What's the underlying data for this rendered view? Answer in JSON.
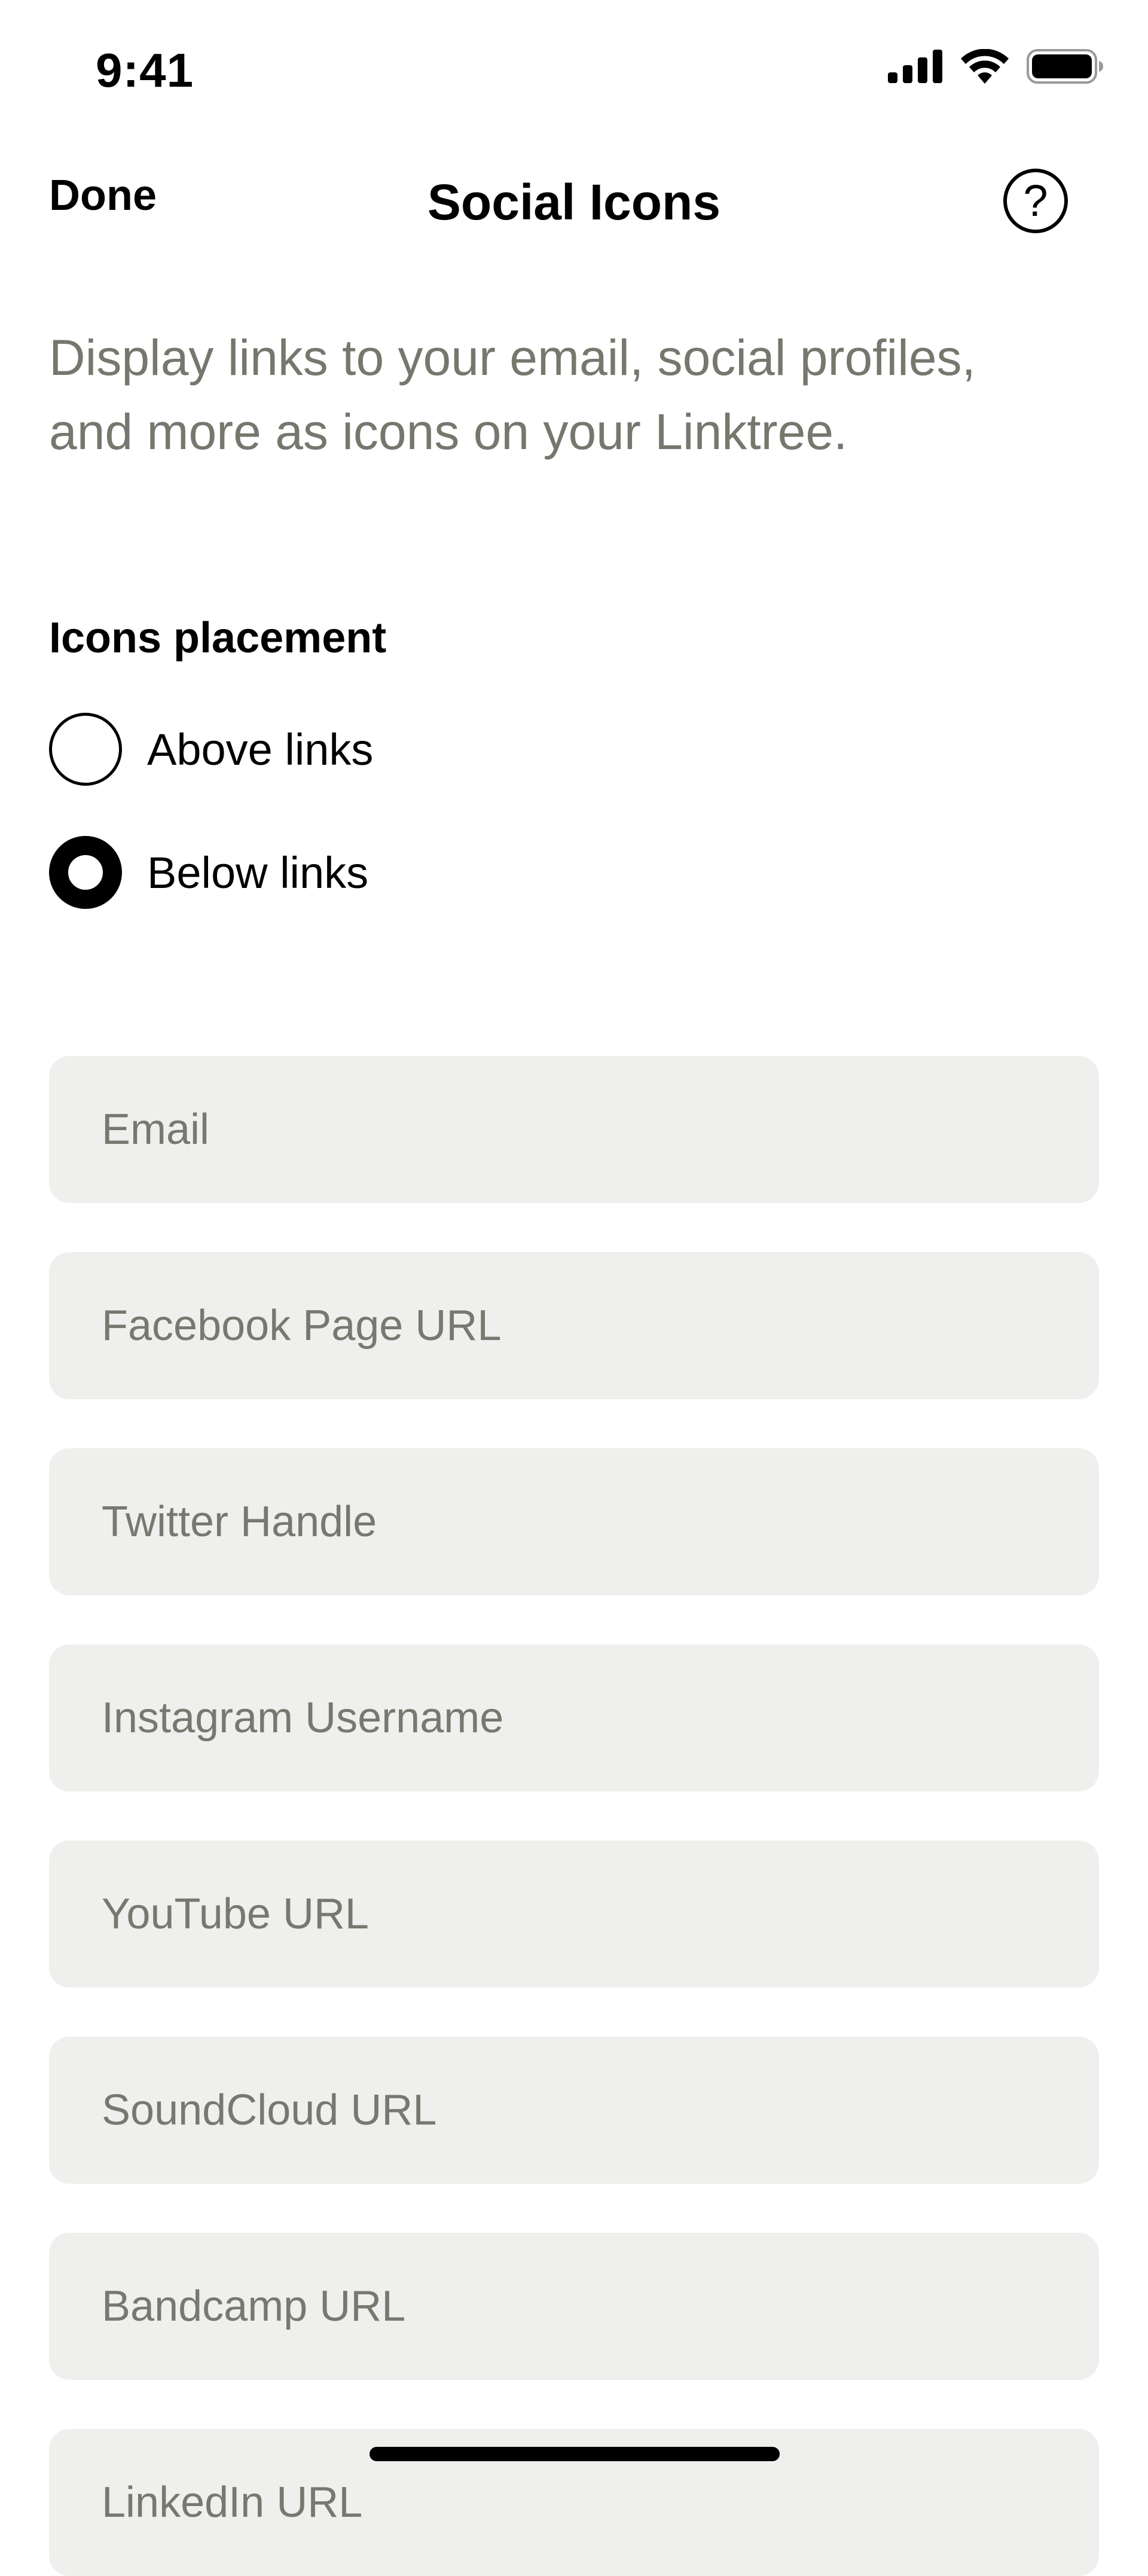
{
  "status_bar": {
    "time": "9:41",
    "icons": [
      "cellular-signal-icon",
      "wifi-icon",
      "battery-icon"
    ]
  },
  "nav": {
    "done_label": "Done",
    "title": "Social Icons",
    "help_glyph": "?"
  },
  "description": "Display links to your email, social profiles, and more as icons on your Linktree.",
  "placement": {
    "label": "Icons placement",
    "options": [
      {
        "label": "Above links",
        "selected": false
      },
      {
        "label": "Below links",
        "selected": true
      }
    ]
  },
  "fields": [
    {
      "placeholder": "Email",
      "value": ""
    },
    {
      "placeholder": "Facebook Page URL",
      "value": ""
    },
    {
      "placeholder": "Twitter Handle",
      "value": ""
    },
    {
      "placeholder": "Instagram Username",
      "value": ""
    },
    {
      "placeholder": "YouTube URL",
      "value": ""
    },
    {
      "placeholder": "SoundCloud URL",
      "value": ""
    },
    {
      "placeholder": "Bandcamp URL",
      "value": ""
    },
    {
      "placeholder": "LinkedIn URL",
      "value": ""
    }
  ],
  "colors": {
    "text_primary": "#000000",
    "text_secondary": "#76776d",
    "field_background": "#efefed",
    "background": "#ffffff"
  }
}
